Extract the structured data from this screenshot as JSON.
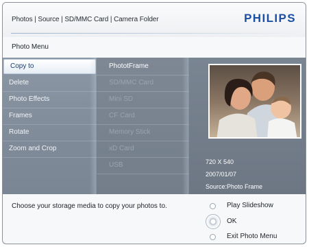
{
  "header": {
    "breadcrumb": "Photos | Source | SD/MMC Card | Camera Folder",
    "logo": "PHILIPS"
  },
  "menu_title": "Photo Menu",
  "menu": {
    "items": [
      "Copy to",
      "Delete",
      "Photo Effects",
      "Frames",
      "Rotate",
      "Zoom and Crop"
    ],
    "selected": "Copy to"
  },
  "destinations": {
    "items": [
      "PhototFrame",
      "SD/MMC Card",
      "Mini SD",
      "CF Card",
      "Memory Stick",
      "xD Card",
      "USB"
    ],
    "active": "PhototFrame"
  },
  "preview": {
    "resolution": "720 X 540",
    "date": "2007/01/07",
    "source": "Source:Photo Frame"
  },
  "footer": {
    "instruction": "Choose your storage media to copy your photos to.",
    "options": [
      "Play Slideshow",
      "OK",
      "Exit Photo Menu"
    ]
  },
  "colors": {
    "brand": "#1b4fa3",
    "panel": "#7d8895",
    "selection": "#ffffff"
  }
}
